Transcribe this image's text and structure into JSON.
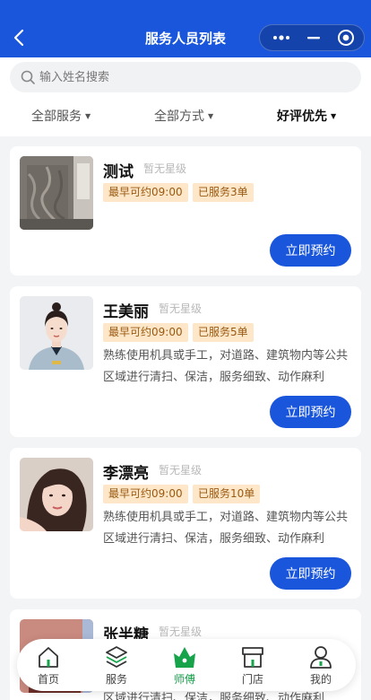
{
  "navbar": {
    "title": "服务人员列表"
  },
  "search": {
    "placeholder": "输入姓名搜索"
  },
  "filters": [
    {
      "label": "全部服务",
      "active": false
    },
    {
      "label": "全部方式",
      "active": false
    },
    {
      "label": "好评优先",
      "active": true
    }
  ],
  "staff": [
    {
      "name": "测试",
      "rating": "暂无星级",
      "earliest": "最早可约09:00",
      "served": "已服务3单",
      "description": "",
      "button": "立即预约"
    },
    {
      "name": "王美丽",
      "rating": "暂无星级",
      "earliest": "最早可约09:00",
      "served": "已服务5单",
      "description": "熟练使用机具或手工，对道路、建筑物内等公共区域进行清扫、保洁，服务细致、动作麻利",
      "button": "立即预约"
    },
    {
      "name": "李漂亮",
      "rating": "暂无星级",
      "earliest": "最早可约09:00",
      "served": "已服务10单",
      "description": "熟练使用机具或手工，对道路、建筑物内等公共区域进行清扫、保洁，服务细致、动作麻利",
      "button": "立即预约"
    },
    {
      "name": "张半糖",
      "rating": "暂无星级",
      "earliest": "",
      "served": "",
      "description": "区域进行清扫、保洁，服务细致、动作麻利",
      "button": ""
    }
  ],
  "tabbar": [
    {
      "label": "首页",
      "icon": "home-icon",
      "active": false
    },
    {
      "label": "服务",
      "icon": "layers-icon",
      "active": false
    },
    {
      "label": "师傅",
      "icon": "crown-icon",
      "active": true
    },
    {
      "label": "门店",
      "icon": "store-icon",
      "active": false
    },
    {
      "label": "我的",
      "icon": "user-icon",
      "active": false
    }
  ],
  "colors": {
    "primary": "#1a56db",
    "tag_bg": "#fde7c8",
    "tag_text": "#9a5a12",
    "active_tab": "#16a34a"
  }
}
